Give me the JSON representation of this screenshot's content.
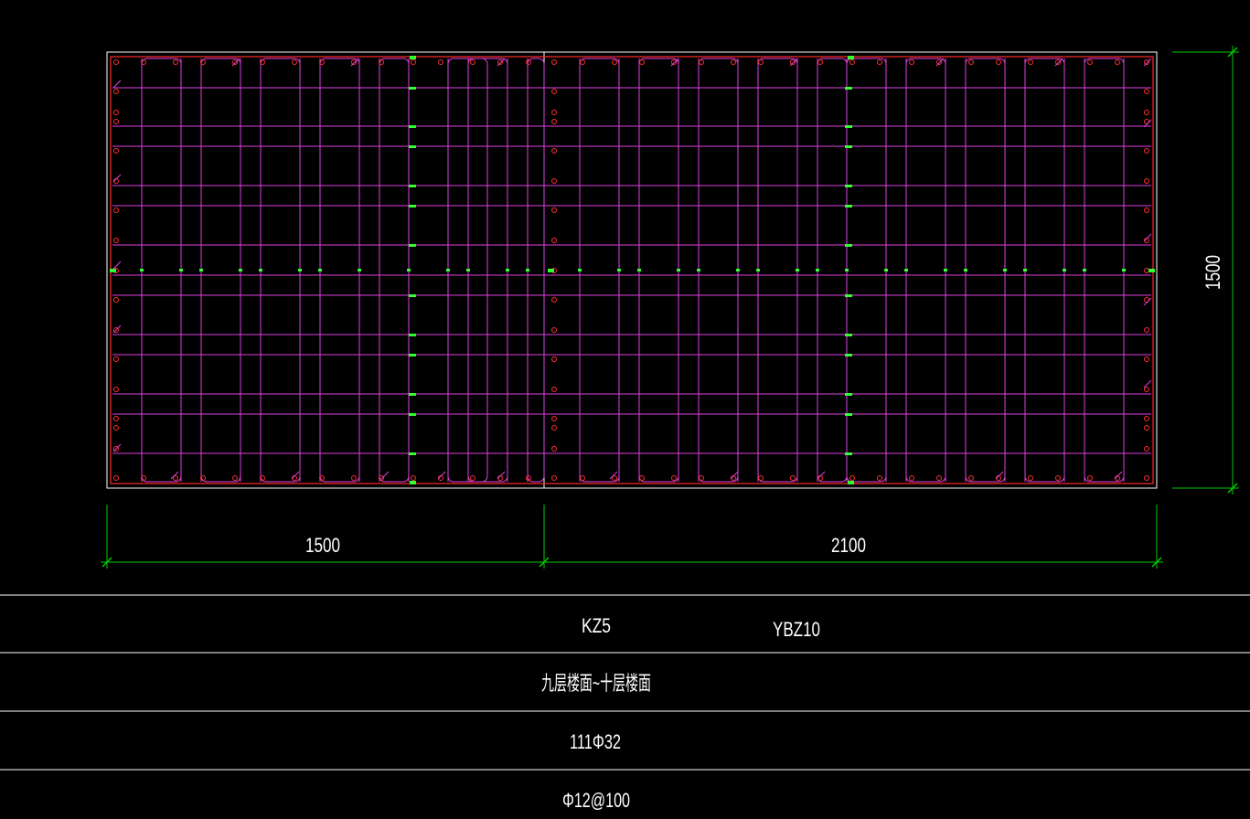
{
  "drawing": {
    "colors": {
      "background": "#000000",
      "outline": "#ffffff",
      "perimeter_hoop": "#ff2a2a",
      "tie_grid": "#e040e0",
      "rebar_dot": "#ff3030",
      "dimension": "#00d000",
      "divider": "#ffffff",
      "mark": "#30ff30"
    },
    "dimensions": {
      "width_left": "1500",
      "width_right": "2100",
      "height": "1500"
    }
  },
  "table": {
    "row1": {
      "name_a": "KZ5",
      "name_b": "YBZ10"
    },
    "row2": {
      "floor_range": "九层楼面~十层楼面"
    },
    "row3": {
      "longitudinal_bars": "111Φ32"
    },
    "row4": {
      "stirrups": "Φ12@100"
    }
  }
}
